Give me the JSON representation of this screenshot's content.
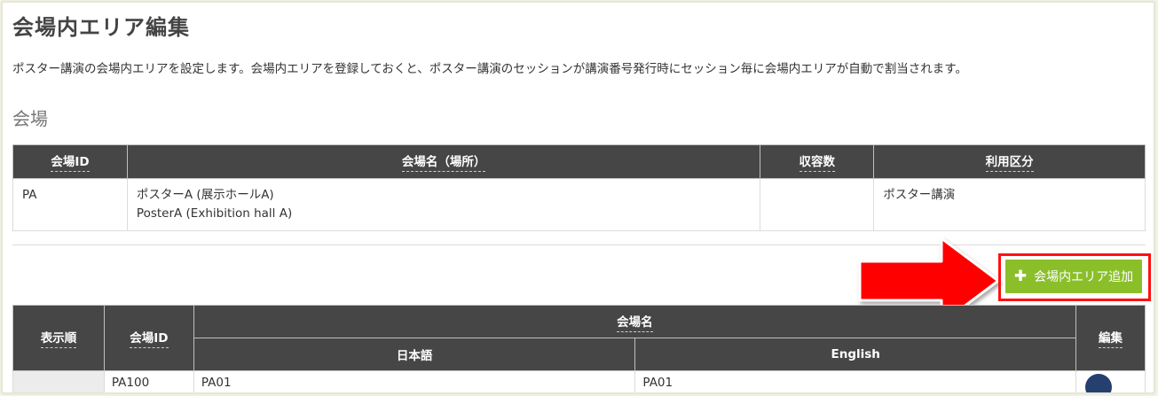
{
  "page": {
    "title": "会場内エリア編集",
    "description": "ポスター講演の会場内エリアを設定します。会場内エリアを登録しておくと、ポスター講演のセッションが講演番号発行時にセッション毎に会場内エリアが自動で割当されます。"
  },
  "venue_section": {
    "title": "会場",
    "headers": {
      "id": "会場ID",
      "name": "会場名（場所）",
      "capacity": "収容数",
      "usage": "利用区分"
    },
    "rows": [
      {
        "id": "PA",
        "name_ja": "ポスターA (展示ホールA)",
        "name_en": "PosterA (Exhibition hall A)",
        "capacity": "",
        "usage": "ポスター講演"
      }
    ]
  },
  "add_button": {
    "icon": "plus-icon",
    "label": "会場内エリア追加"
  },
  "area_table": {
    "headers": {
      "order": "表示順",
      "id": "会場ID",
      "name": "会場名",
      "name_ja": "日本語",
      "name_en": "English",
      "edit": "編集"
    },
    "rows": [
      {
        "order": "",
        "id": "PA100",
        "name_ja": "PA01",
        "name_en": "PA01"
      }
    ]
  },
  "colors": {
    "header_bg": "#464646",
    "accent_green": "#8bbf2a",
    "annotation_red": "#ff1010",
    "edit_button": "#253f6e"
  }
}
